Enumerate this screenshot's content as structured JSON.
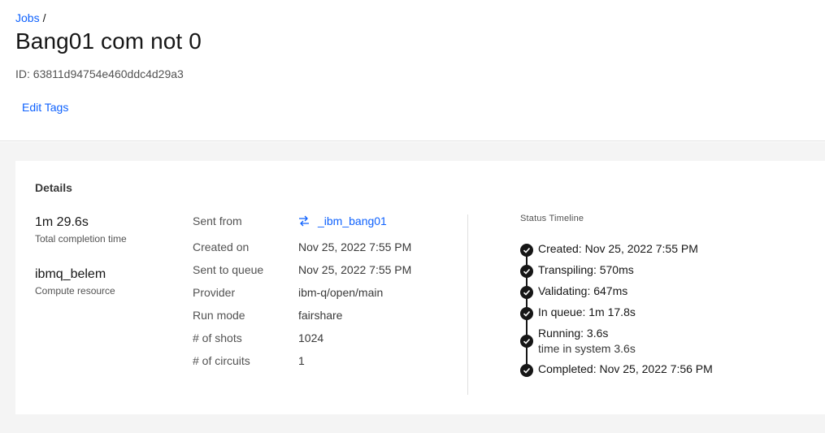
{
  "breadcrumb": {
    "parent": "Jobs",
    "separator": "/"
  },
  "page": {
    "title": "Bang01 com not 0",
    "job_id": "ID: 63811d94754e460ddc4d29a3",
    "edit_tags": "Edit Tags"
  },
  "details": {
    "title": "Details",
    "completion_time": {
      "value": "1m 29.6s",
      "label": "Total completion time"
    },
    "compute_resource": {
      "value": "ibmq_belem",
      "label": "Compute resource"
    },
    "properties": [
      {
        "key": "Sent from",
        "value": "_ibm_bang01",
        "is_link": true,
        "icon": "transfer-icon"
      },
      {
        "key": "Created on",
        "value": "Nov 25, 2022 7:55 PM"
      },
      {
        "key": "Sent to queue",
        "value": "Nov 25, 2022 7:55 PM"
      },
      {
        "key": "Provider",
        "value": "ibm-q/open/main"
      },
      {
        "key": "Run mode",
        "value": "fairshare"
      },
      {
        "key": "# of shots",
        "value": "1024"
      },
      {
        "key": "# of circuits",
        "value": "1"
      }
    ]
  },
  "status_timeline": {
    "title": "Status Timeline",
    "steps": [
      {
        "label": "Created: Nov 25, 2022 7:55 PM"
      },
      {
        "label": "Transpiling: 570ms"
      },
      {
        "label": "Validating: 647ms"
      },
      {
        "label": "In queue: 1m 17.8s"
      },
      {
        "label": "Running: 3.6s",
        "sub": "time in system 3.6s"
      },
      {
        "label": "Completed: Nov 25, 2022 7:56 PM"
      }
    ]
  },
  "colors": {
    "link": "#0f62fe",
    "text": "#161616",
    "background": "#f4f4f4"
  }
}
